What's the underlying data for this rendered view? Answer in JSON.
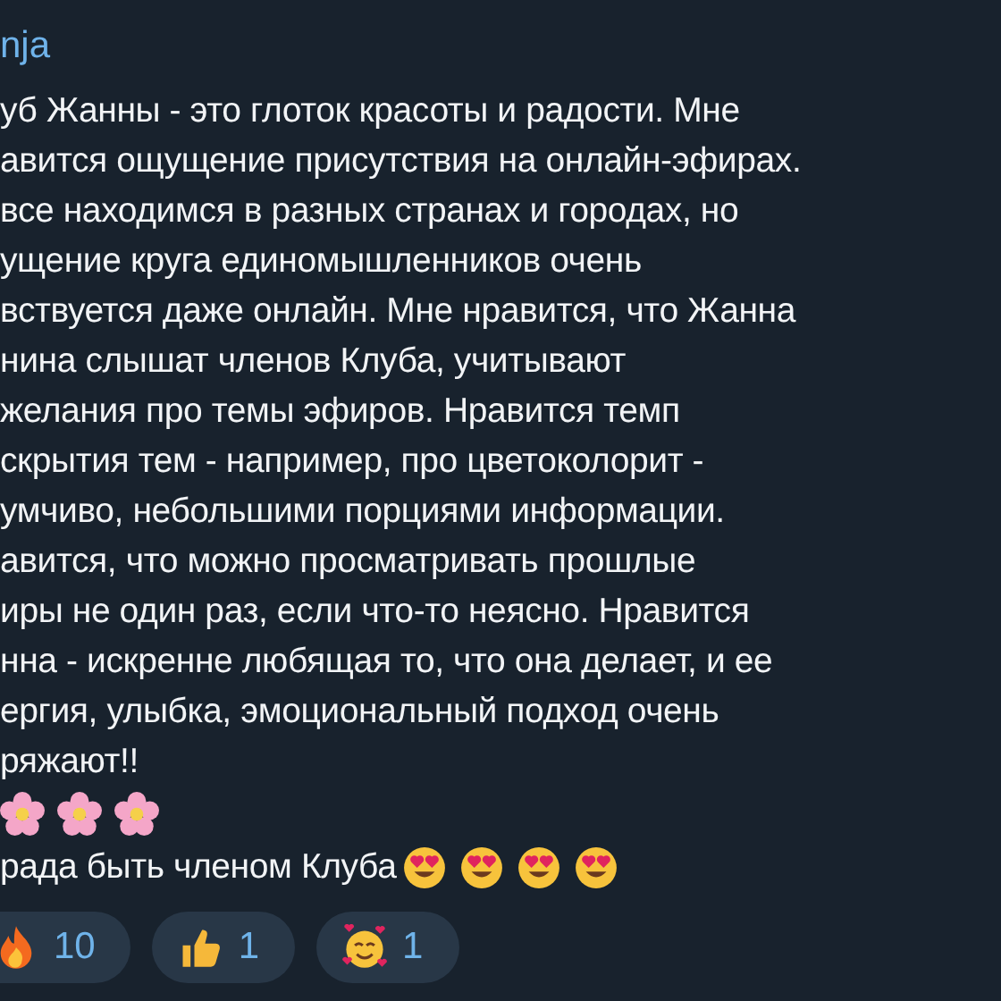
{
  "message": {
    "author": "nja",
    "lines": [
      "уб Жанны - это глоток красоты и радости. Мне",
      "авится ощущение присутствия на онлайн-эфирах.",
      "все находимся в разных странах и городах, но",
      "ущение круга единомышленников очень",
      "вствуется даже онлайн. Мне нравится, что Жанна",
      "нина слышат членов Клуба, учитывают",
      "желания про темы эфиров. Нравится темп",
      "скрытия тем - например, про цветоколорит -",
      "умчиво, небольшими порциями информации.",
      "авится, что можно просматривать прошлые",
      "иры не один раз, если что-то неясно. Нравится",
      "нна - искренне любящая то, что она делает, и ее",
      "ергия, улыбка, эмоциональный подход очень",
      "ряжают!!"
    ],
    "closing": "рада быть членом Клуба"
  },
  "reactions": [
    {
      "kind": "fire",
      "count": "10"
    },
    {
      "kind": "thumbs-up",
      "count": "1"
    },
    {
      "kind": "hearts-face",
      "count": "1"
    }
  ]
}
